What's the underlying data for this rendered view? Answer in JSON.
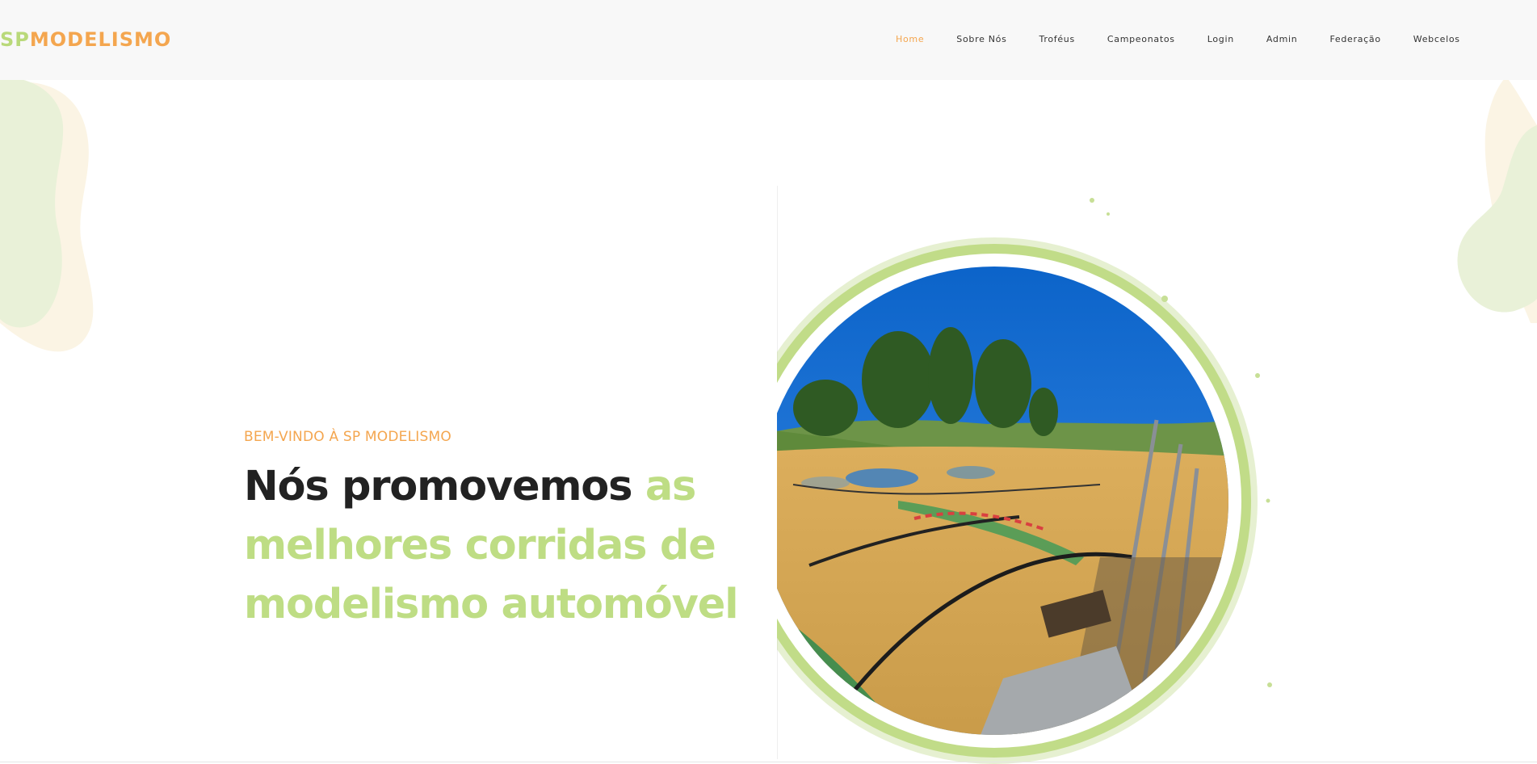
{
  "brand": {
    "logo_prefix": "SP",
    "logo_suffix": "MODELISMO"
  },
  "nav": {
    "items": [
      {
        "label": "Home",
        "active": true
      },
      {
        "label": "Sobre Nós"
      },
      {
        "label": "Troféus"
      },
      {
        "label": "Campeonatos"
      },
      {
        "label": "Login"
      },
      {
        "label": "Admin"
      },
      {
        "label": "Federação"
      },
      {
        "label": "Webcelos"
      }
    ]
  },
  "hero": {
    "eyebrow": "BEM-VINDO À SP MODELISMO",
    "title_dark": "Nós promovemos ",
    "title_highlight": "as melhores corridas de modelismo automóvel"
  },
  "colors": {
    "accent_orange": "#f4a64f",
    "accent_green": "#bedd84",
    "header_bg": "#f8f8f8",
    "text_dark": "#222222"
  }
}
